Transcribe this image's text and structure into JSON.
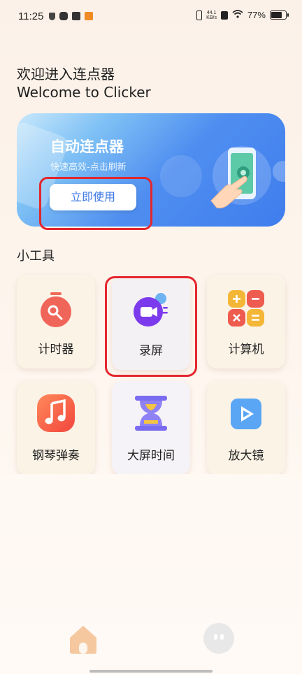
{
  "status_bar": {
    "time": "11:25",
    "net_speed_top": "44.1",
    "net_speed_bottom": "KB/s",
    "battery": "77%"
  },
  "header": {
    "welcome_cn": "欢迎进入连点器",
    "welcome_en": "Welcome to Clicker"
  },
  "banner": {
    "title": "自动连点器",
    "subtitle": "快速高效-点击刷新",
    "button_label": "立即使用"
  },
  "tools": {
    "section_title": "小工具",
    "items": [
      {
        "label": "计时器",
        "icon": "timer-icon"
      },
      {
        "label": "录屏",
        "icon": "screen-record-icon"
      },
      {
        "label": "计算机",
        "icon": "calculator-icon"
      },
      {
        "label": "钢琴弹奏",
        "icon": "music-note-icon"
      },
      {
        "label": "大屏时间",
        "icon": "hourglass-icon"
      },
      {
        "label": "放大镜",
        "icon": "play-icon"
      }
    ]
  },
  "nav": {
    "items": [
      "home-icon",
      "profile-face-icon"
    ]
  },
  "colors": {
    "highlight_red": "#e4262d",
    "banner_blue": "#3f7ded",
    "home_orange": "#f6c89f"
  }
}
